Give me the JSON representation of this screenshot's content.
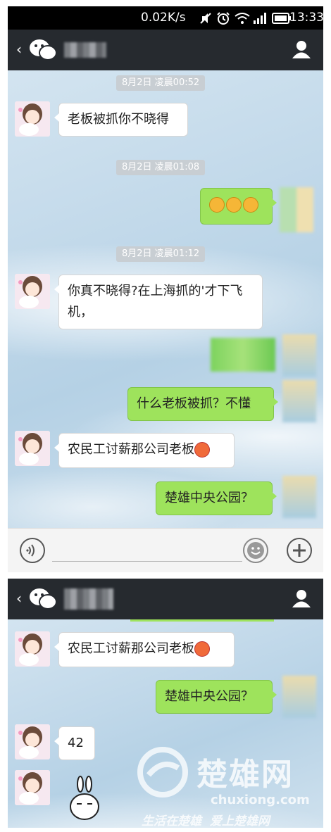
{
  "status_bar": {
    "network_speed": "0.02K/s",
    "time": "13:33"
  },
  "timestamps": [
    "8月2日 凌晨00:52",
    "8月2日 凌晨01:08",
    "8月2日 凌晨01:12"
  ],
  "messages": {
    "m1": "老板被抓你不晓得",
    "m2_emoji": "😲😲😲",
    "m3": "你真不晓得?在上海抓的'才下飞机，",
    "m5": "什么老板被抓？不懂",
    "m6": "农民工讨薪那公司老板",
    "m7": "楚雄中央公园？",
    "m8": "42"
  },
  "watermark": {
    "brand": "楚雄网",
    "domain": "chuxiong.com",
    "slogan": "生活在楚雄  爱上楚雄网"
  },
  "colors": {
    "header_bg": "#262a2f",
    "bubble_out": "#9ee35c",
    "bubble_in": "#ffffff",
    "chat_bg": "#c2d9ea"
  }
}
